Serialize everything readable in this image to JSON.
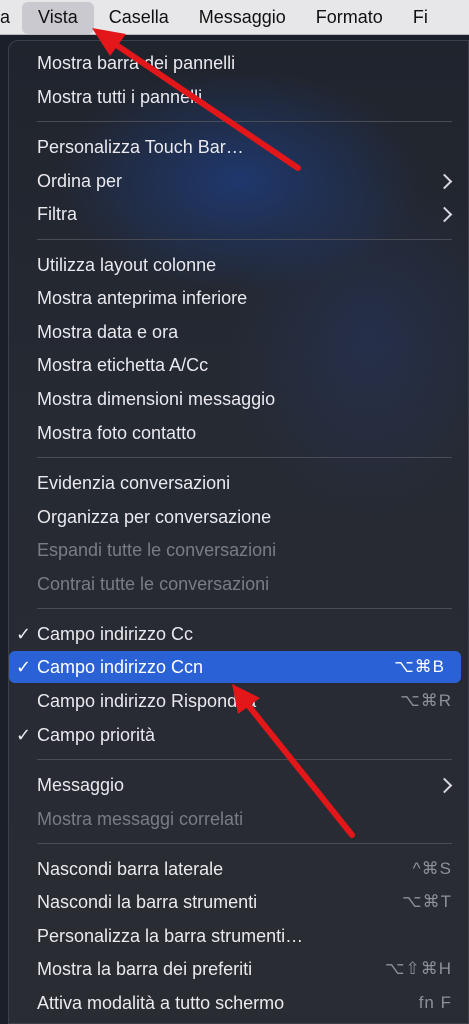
{
  "menubar": {
    "items": [
      {
        "label": "a"
      },
      {
        "label": "Vista"
      },
      {
        "label": "Casella"
      },
      {
        "label": "Messaggio"
      },
      {
        "label": "Formato"
      },
      {
        "label": "Fi"
      }
    ]
  },
  "menu": {
    "items": [
      {
        "label": "Mostra barra dei pannelli"
      },
      {
        "label": "Mostra tutti i pannelli"
      },
      {
        "label": "Personalizza Touch Bar…"
      },
      {
        "label": "Ordina per"
      },
      {
        "label": "Filtra"
      },
      {
        "label": "Utilizza layout colonne"
      },
      {
        "label": "Mostra anteprima inferiore"
      },
      {
        "label": "Mostra data e ora"
      },
      {
        "label": "Mostra etichetta A/Cc"
      },
      {
        "label": "Mostra dimensioni messaggio"
      },
      {
        "label": "Mostra foto contatto"
      },
      {
        "label": "Evidenzia conversazioni"
      },
      {
        "label": "Organizza per conversazione"
      },
      {
        "label": "Espandi tutte le conversazioni"
      },
      {
        "label": "Contrai tutte le conversazioni"
      },
      {
        "label": "Campo indirizzo Cc",
        "check": "✓"
      },
      {
        "label": "Campo indirizzo Ccn",
        "check": "✓",
        "shortcut": "⌥⌘B"
      },
      {
        "label": "Campo indirizzo Rispondi a",
        "shortcut": "⌥⌘R"
      },
      {
        "label": "Campo priorità",
        "check": "✓"
      },
      {
        "label": "Messaggio"
      },
      {
        "label": "Mostra messaggi correlati"
      },
      {
        "label": "Nascondi barra laterale",
        "shortcut": "^⌘S"
      },
      {
        "label": "Nascondi la barra strumenti",
        "shortcut": "⌥⌘T"
      },
      {
        "label": "Personalizza la barra strumenti…"
      },
      {
        "label": "Mostra la barra dei preferiti",
        "shortcut": "⌥⇧⌘H"
      },
      {
        "label": "Attiva modalità a tutto schermo",
        "shortcut": "fn F"
      }
    ]
  },
  "colors": {
    "highlight": "#2a62d6",
    "annotation_arrow": "#e3161a"
  }
}
